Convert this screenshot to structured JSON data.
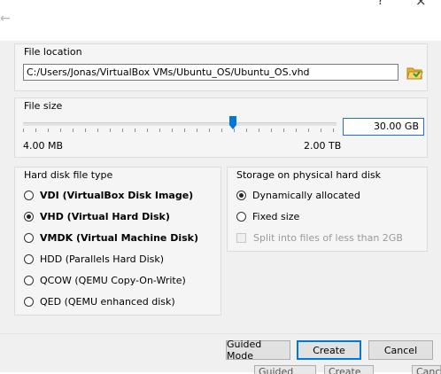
{
  "window": {
    "back_icon": "arrow-left-icon",
    "help_glyph": "?",
    "close_glyph": "×"
  },
  "file_location": {
    "title": "File location",
    "path": "C:/Users/Jonas/VirtualBox VMs/Ubuntu_OS/Ubuntu_OS.vhd",
    "folder_icon": "folder-icon"
  },
  "file_size": {
    "title": "File size",
    "value": "30.00 GB",
    "min_label": "4.00 MB",
    "max_label": "2.00 TB",
    "slider_fraction": 0.67
  },
  "disk_type": {
    "title": "Hard disk file type",
    "options": [
      {
        "label": "VDI (VirtualBox Disk Image)",
        "checked": false,
        "bold": true
      },
      {
        "label": "VHD (Virtual Hard Disk)",
        "checked": true,
        "bold": true
      },
      {
        "label": "VMDK (Virtual Machine Disk)",
        "checked": false,
        "bold": true
      },
      {
        "label": "HDD (Parallels Hard Disk)",
        "checked": false,
        "bold": false
      },
      {
        "label": "QCOW (QEMU Copy-On-Write)",
        "checked": false,
        "bold": false
      },
      {
        "label": "QED (QEMU enhanced disk)",
        "checked": false,
        "bold": false
      }
    ]
  },
  "storage": {
    "title": "Storage on physical hard disk",
    "options": [
      {
        "label": "Dynamically allocated",
        "checked": true
      },
      {
        "label": "Fixed size",
        "checked": false
      }
    ],
    "split_label": "Split into files of less than 2GB",
    "split_enabled": false
  },
  "buttons": {
    "guided": "Guided Mode",
    "create": "Create",
    "cancel": "Cancel"
  },
  "behind_window": {
    "guided": "Guided Mode",
    "create": "Create",
    "cancel": "Cance"
  },
  "colors": {
    "accent": "#0078d7",
    "dialog_bg": "#f0f0f0"
  }
}
